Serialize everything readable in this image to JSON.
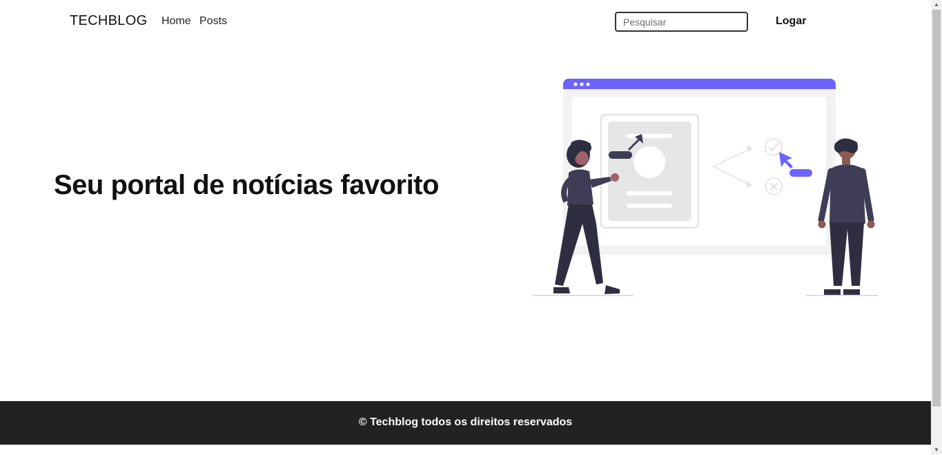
{
  "header": {
    "brand": "TECHBLOG",
    "nav": {
      "home": "Home",
      "posts": "Posts"
    },
    "search": {
      "placeholder": "Pesquisar",
      "value": ""
    },
    "login": "Logar"
  },
  "hero": {
    "title": "Seu portal de notícias favorito"
  },
  "footer": {
    "text": "© Techblog todos os direitos reservados"
  },
  "colors": {
    "accent": "#6c63ff",
    "footer_bg": "#222222",
    "figure_dark": "#2f2e41"
  },
  "icons": [
    "check-icon",
    "close-icon",
    "cursor-arrow-icon",
    "scroll-up-arrow-icon",
    "scroll-down-arrow-icon"
  ]
}
